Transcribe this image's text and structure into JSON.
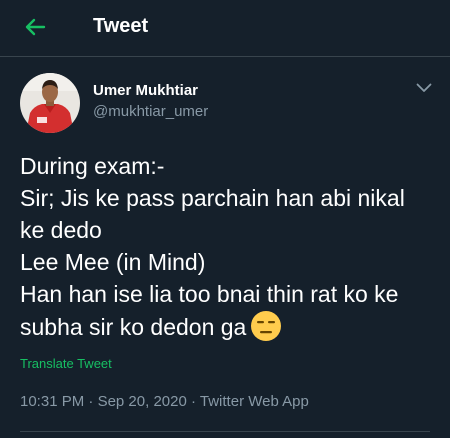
{
  "header": {
    "title": "Tweet",
    "back_icon": "arrow-left-icon"
  },
  "author": {
    "name": "Umer Mukhtiar",
    "handle": "@mukhtiar_umer",
    "avatar_icon": "avatar-photo",
    "menu_icon": "chevron-down-icon"
  },
  "tweet": {
    "lines": [
      "During exam:-",
      "Sir; Jis ke pass parchain han  abi nikal",
      "ke dedo",
      "Lee Mee (in Mind)",
      "Han han ise lia too bnai thin rat ko ke",
      "subha sir ko dedon ga"
    ],
    "emoji": "expressionless-face-emoji",
    "translate_label": "Translate Tweet",
    "time": "10:31 PM",
    "separator": "·",
    "date": "Sep 20, 2020",
    "source": "Twitter Web App"
  },
  "colors": {
    "background": "#15202b",
    "accent": "#17bf63",
    "secondary_text": "#8899a6",
    "border": "#38444d"
  }
}
